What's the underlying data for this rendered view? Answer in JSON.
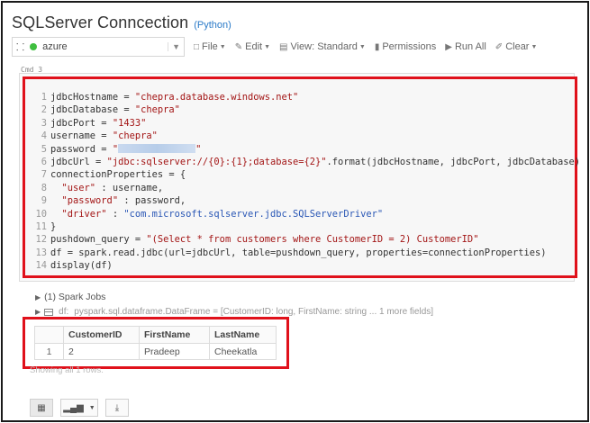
{
  "notebook": {
    "title": "SQLServer Conncection",
    "language": "(Python)"
  },
  "toolbar": {
    "cluster_name": "azure",
    "items": [
      {
        "icon": "file-icon",
        "label": "File"
      },
      {
        "icon": "edit-icon",
        "label": "Edit"
      },
      {
        "icon": "view-icon",
        "label": "View: Standard"
      },
      {
        "icon": "lock-icon",
        "label": "Permissions"
      },
      {
        "icon": "run-icon",
        "label": "Run All"
      },
      {
        "icon": "eraser-icon",
        "label": "Clear"
      }
    ]
  },
  "cell": {
    "label": "Cmd 3",
    "line_numbers": [
      "1",
      "2",
      "3",
      "4",
      "5",
      "6",
      "7",
      "8",
      "9",
      "10",
      "11",
      "12",
      "13",
      "14"
    ],
    "code": {
      "l1_a": "jdbcHostname = ",
      "l1_b": "\"chepra.database.windows.net\"",
      "l2_a": "jdbcDatabase = ",
      "l2_b": "\"chepra\"",
      "l3_a": "jdbcPort = ",
      "l3_b": "\"1433\"",
      "l4_a": "username = ",
      "l4_b": "\"chepra\"",
      "l5_a": "password = ",
      "l5_b": "\"",
      "l5_c": "\"",
      "l6_a": "jdbcUrl = ",
      "l6_b": "\"jdbc:sqlserver://{0}:{1};database={2}\"",
      "l6_c": ".format(jdbcHostname, jdbcPort, jdbcDatabase)",
      "l7": "connectionProperties = {",
      "l8_a": "  ",
      "l8_b": "\"user\"",
      "l8_c": " : username,",
      "l9_a": "  ",
      "l9_b": "\"password\"",
      "l9_c": " : password,",
      "l10_a": "  ",
      "l10_b": "\"driver\"",
      "l10_c": " : ",
      "l10_d": "\"com.microsoft.sqlserver.jdbc.SQLServerDriver\"",
      "l11": "}",
      "l12_a": "pushdown_query = ",
      "l12_b": "\"(Select * from customers where CustomerID = 2) CustomerID\"",
      "l13": "df = spark.read.jdbc(url=jdbcUrl, table=pushdown_query, properties=connectionProperties)",
      "l14": "display(df)"
    }
  },
  "output": {
    "spark_jobs": "(1) Spark Jobs",
    "df_prefix": "df:",
    "df_schema": "pyspark.sql.dataframe.DataFrame = [CustomerID: long, FirstName: string ... 1 more fields]",
    "columns": [
      "CustomerID",
      "FirstName",
      "LastName"
    ],
    "rows": [
      {
        "index": "1",
        "CustomerID": "2",
        "FirstName": "Pradeep",
        "LastName": "Cheekatla"
      }
    ],
    "showing": "Showing all 1 rows."
  },
  "colors": {
    "highlight_border": "#e0111b",
    "string_red": "#a31515",
    "string_blue": "#2a57b5",
    "cluster_status": "#3fbf3f"
  }
}
